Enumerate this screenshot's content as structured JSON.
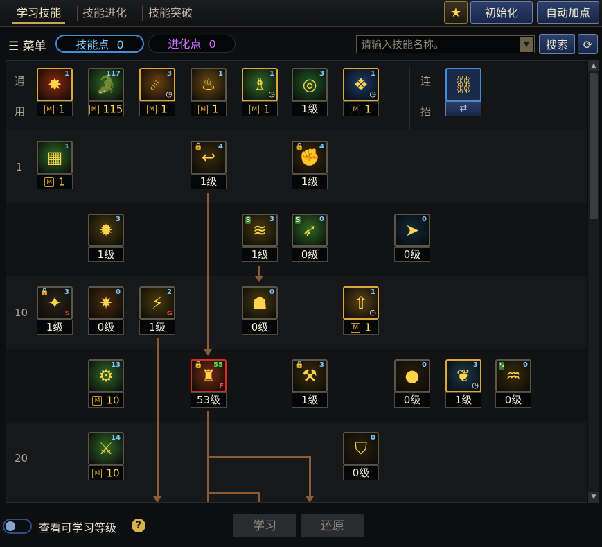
{
  "tabs": [
    {
      "label": "学习技能",
      "active": true
    },
    {
      "label": "技能进化",
      "active": false
    },
    {
      "label": "技能突破",
      "active": false
    }
  ],
  "header_buttons": {
    "init": "初始化",
    "auto": "自动加点"
  },
  "menu": {
    "label": "菜单",
    "skill_points_label": "技能点",
    "skill_points_value": "0",
    "evo_points_label": "进化点",
    "evo_points_value": "0"
  },
  "search": {
    "placeholder": "请输入技能名称。",
    "button": "搜索"
  },
  "tree": {
    "general_label": [
      "通",
      "用"
    ],
    "combo_label": [
      "连",
      "招"
    ],
    "row_labels": [
      "1",
      "10",
      "20"
    ],
    "skills": [
      {
        "row": "general",
        "col": 0,
        "num": "1",
        "level": "1",
        "m": true,
        "icon": "✸",
        "frame": "gold",
        "bg": "#8a2a0a"
      },
      {
        "row": "general",
        "col": 1,
        "num": "117",
        "level": "115",
        "m": true,
        "icon": "🐊",
        "frame": "grey",
        "bg": "#2f6a26"
      },
      {
        "row": "general",
        "col": 2,
        "num": "3",
        "level": "1",
        "m": true,
        "icon": "☄",
        "frame": "gold",
        "bg": "#6a3f10",
        "clock": true
      },
      {
        "row": "general",
        "col": 3,
        "num": "1",
        "level": "1",
        "m": true,
        "icon": "♨",
        "frame": "grey",
        "bg": "#6a4a10"
      },
      {
        "row": "general",
        "col": 4,
        "num": "1",
        "level": "1",
        "m": true,
        "icon": "♗",
        "frame": "gold",
        "bg": "#2f6a26",
        "clock": true
      },
      {
        "row": "general",
        "col": 5,
        "num": "3",
        "level": "1级",
        "m": false,
        "icon": "◎",
        "frame": "grey",
        "bg": "#1f5a26"
      },
      {
        "row": "general",
        "col": 6,
        "num": "1",
        "level": "1",
        "m": true,
        "icon": "❖",
        "frame": "gold",
        "bg": "#1a3a6a",
        "clock": true
      },
      {
        "row": "r1",
        "col": 0,
        "num": "1",
        "level": "1",
        "m": true,
        "icon": "▦",
        "frame": "grey",
        "bg": "#2f6a26"
      },
      {
        "row": "r1",
        "col": 3,
        "num": "4",
        "level": "1级",
        "m": false,
        "icon": "↩",
        "frame": "grey",
        "bg": "#3a2a0a",
        "lock": true
      },
      {
        "row": "r1",
        "col": 5,
        "num": "4",
        "level": "1级",
        "m": false,
        "icon": "✊",
        "frame": "grey",
        "bg": "#3a2a0a",
        "lock": true
      },
      {
        "row": "r2",
        "col": 1,
        "num": "3",
        "level": "1级",
        "m": false,
        "icon": "✹",
        "frame": "grey",
        "bg": "#4a3a0a"
      },
      {
        "row": "r2",
        "col": 4,
        "num": "3",
        "level": "1级",
        "m": false,
        "icon": "≋",
        "frame": "grey",
        "bg": "#4a3a0a",
        "stag": true
      },
      {
        "row": "r2",
        "col": 5,
        "num": "0",
        "level": "0级",
        "m": false,
        "icon": "➶",
        "frame": "grey",
        "bg": "#2f6a26",
        "stag": true
      },
      {
        "row": "r2",
        "col": 7,
        "num": "0",
        "level": "0级",
        "m": false,
        "icon": "➤",
        "frame": "grey",
        "bg": "#0f2a3a"
      },
      {
        "row": "r10",
        "col": 0,
        "num": "3",
        "level": "1级",
        "m": false,
        "icon": "✦",
        "frame": "grey",
        "bg": "#2a2416",
        "lock": true,
        "tag": "S",
        "tagcolor": "#ff4040"
      },
      {
        "row": "r10",
        "col": 1,
        "num": "0",
        "level": "0级",
        "m": false,
        "icon": "✷",
        "frame": "grey",
        "bg": "#4a2a0a"
      },
      {
        "row": "r10",
        "col": 2,
        "num": "2",
        "level": "1级",
        "m": false,
        "icon": "⚡",
        "frame": "grey",
        "bg": "#4a3a0a",
        "tag": "G",
        "tagcolor": "#ff4040"
      },
      {
        "row": "r10",
        "col": 4,
        "num": "0",
        "level": "0级",
        "m": false,
        "icon": "☗",
        "frame": "grey",
        "bg": "#4a3a0a"
      },
      {
        "row": "r10",
        "col": 6,
        "num": "1",
        "level": "1",
        "m": true,
        "icon": "⇧",
        "frame": "gold",
        "bg": "#5a4010",
        "clock": true
      },
      {
        "row": "r15",
        "col": 1,
        "num": "13",
        "level": "10",
        "m": true,
        "icon": "⚙",
        "frame": "grey",
        "bg": "#2f6a26"
      },
      {
        "row": "r15",
        "col": 3,
        "num": "55",
        "level": "53级",
        "m": false,
        "icon": "♜",
        "frame": "red",
        "bg": "#7a2a10",
        "lock": true,
        "tag": "F",
        "tagcolor": "#ff4040",
        "numcolor": "#4ae04a"
      },
      {
        "row": "r15",
        "col": 5,
        "num": "3",
        "level": "1级",
        "m": false,
        "icon": "⚒",
        "frame": "grey",
        "bg": "#3a2a0a",
        "lock": true
      },
      {
        "row": "r15",
        "col": 7,
        "num": "0",
        "level": "0级",
        "m": false,
        "icon": "●",
        "frame": "grey",
        "bg": "#2a2008"
      },
      {
        "row": "r15",
        "col": 8,
        "num": "3",
        "level": "1级",
        "m": false,
        "icon": "❦",
        "frame": "gold",
        "bg": "#1a3a4a",
        "clock": true
      },
      {
        "row": "r15",
        "col": 9,
        "num": "0",
        "level": "0级",
        "m": false,
        "icon": "♒",
        "frame": "grey",
        "bg": "#3a2a0a",
        "stag": true
      },
      {
        "row": "r20",
        "col": 1,
        "num": "14",
        "level": "10",
        "m": true,
        "icon": "⚔",
        "frame": "grey",
        "bg": "#2f6a26"
      },
      {
        "row": "r20",
        "col": 6,
        "num": "0",
        "level": "0级",
        "m": false,
        "icon": "⛉",
        "frame": "grey",
        "bg": "#2a2008"
      }
    ]
  },
  "footer": {
    "toggle_label": "查看可学习等级",
    "learn": "学习",
    "restore": "还原"
  }
}
